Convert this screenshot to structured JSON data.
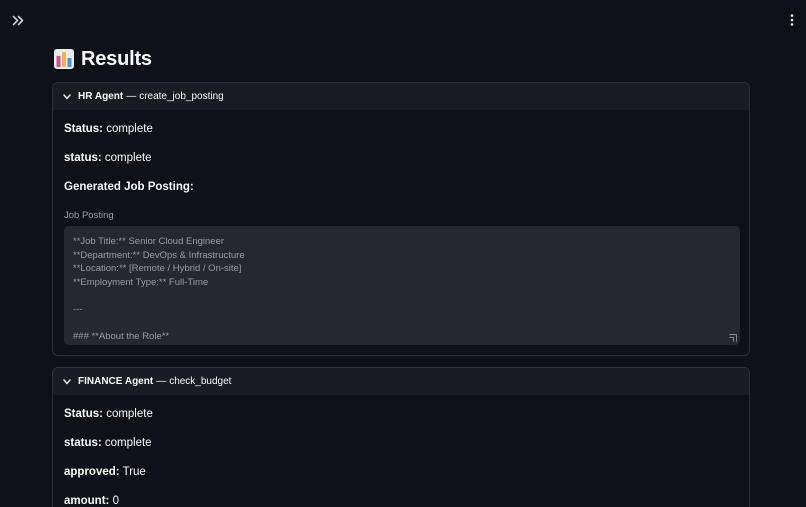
{
  "page": {
    "title": "Results"
  },
  "colors": {
    "background": "#0e1117",
    "expander_header": "#1a1c24",
    "border": "#2e3038",
    "textarea_bg": "#262830",
    "muted_text": "#9a9ca4",
    "text": "#fafafa"
  },
  "icons": {
    "sidebar_toggle": "double-chevron-right-icon",
    "menu": "vertical-ellipsis-icon",
    "title_emoji": "bar-chart-icon",
    "expander_chevron": "chevron-down-icon",
    "resize": "resize-handle-icon"
  },
  "hr_section": {
    "agent": "HR Agent",
    "separator": "—",
    "action": "create_job_posting",
    "status_label": "Status:",
    "status_value": "complete",
    "status2_label": "status:",
    "status2_value": "complete",
    "generated_heading": "Generated Job Posting:",
    "textarea_label": "Job Posting",
    "textarea_lines": [
      "**Job Title:** Senior Cloud Engineer",
      "**Department:** DevOps & Infrastructure",
      "**Location:** [Remote / Hybrid / On-site]",
      "**Employment Type:** Full-Time",
      "",
      "---",
      "",
      "### **About the Role**"
    ]
  },
  "finance_section": {
    "agent": "FINANCE Agent",
    "separator": "—",
    "action": "check_budget",
    "status_label": "Status:",
    "status_value": "complete",
    "status2_label": "status:",
    "status2_value": "complete",
    "approved_label": "approved:",
    "approved_value": "True",
    "amount_label": "amount:",
    "amount_value": "0"
  }
}
